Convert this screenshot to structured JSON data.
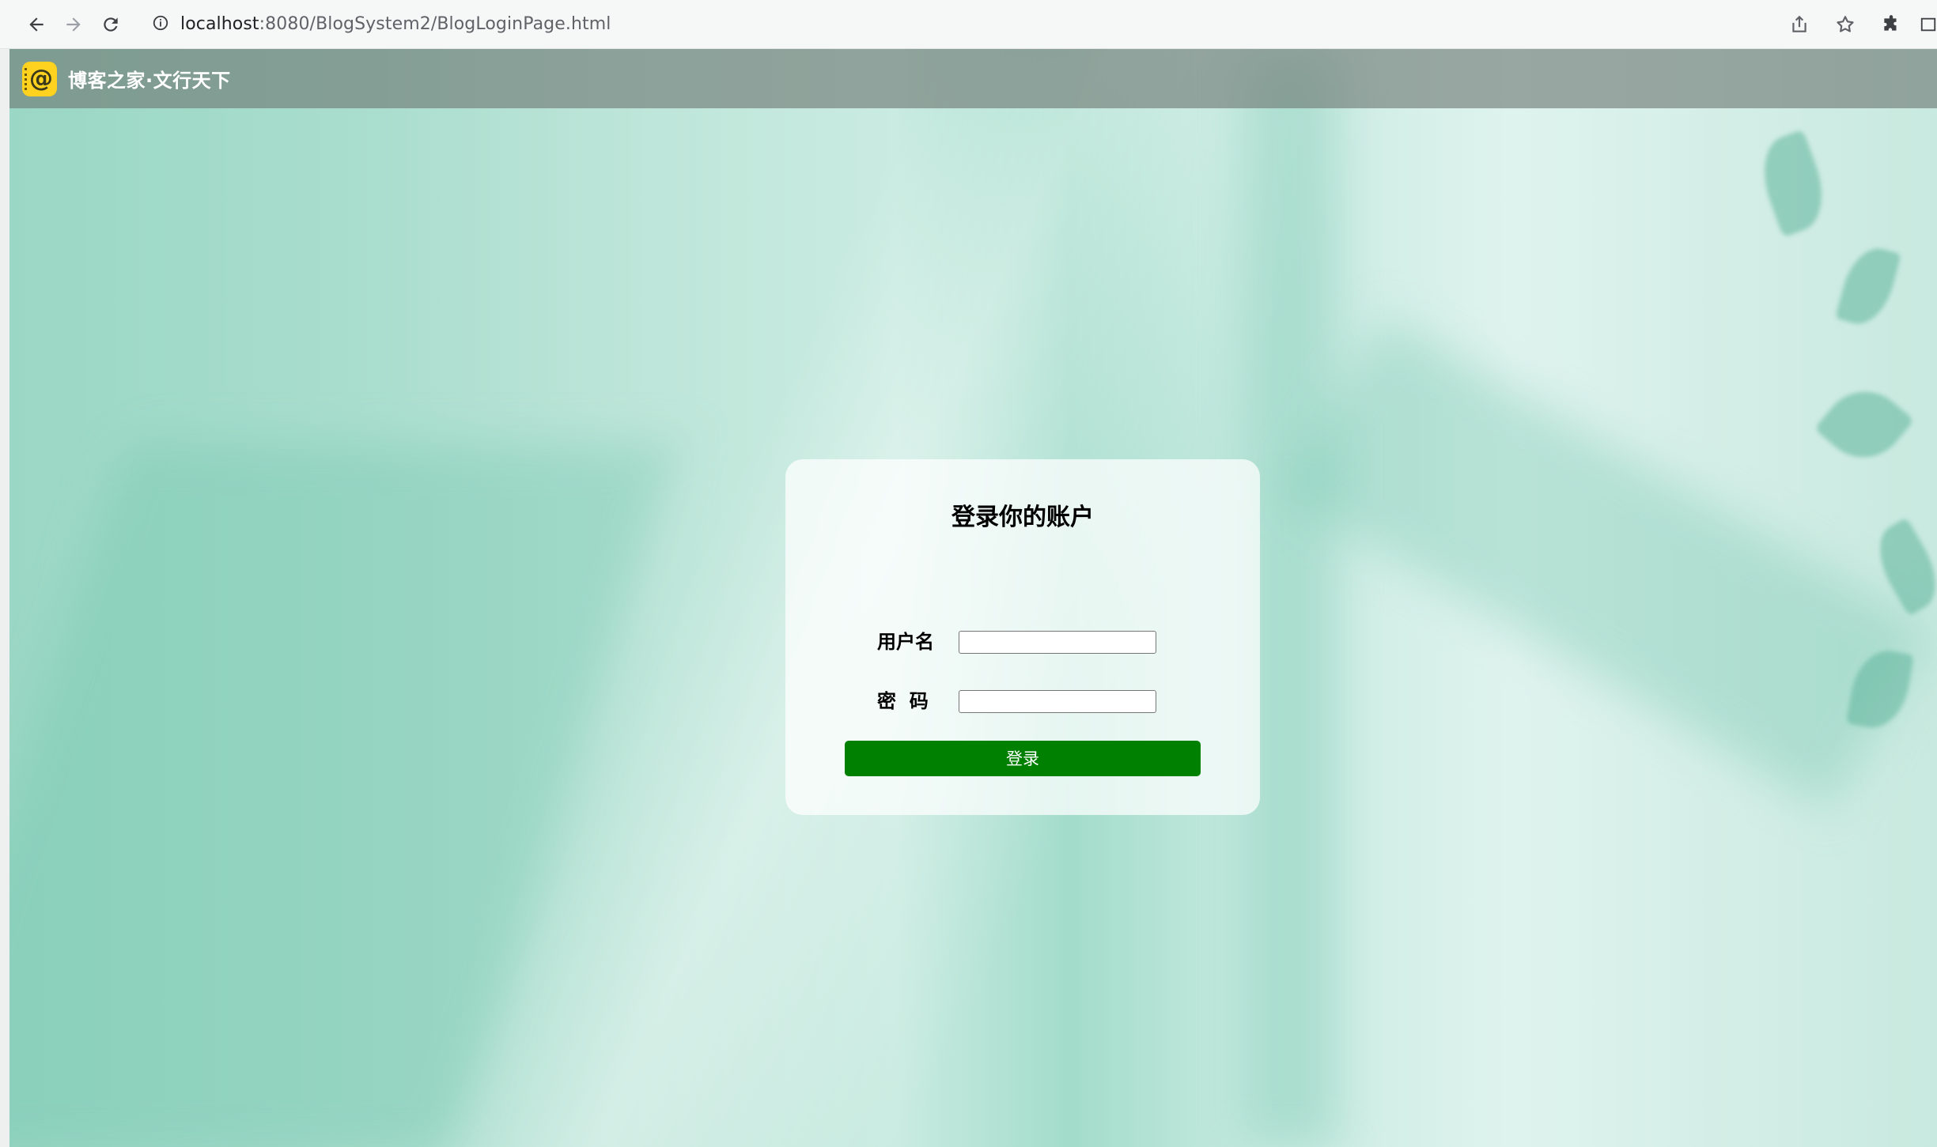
{
  "browser": {
    "url_host": "localhost",
    "url_path": ":8080/BlogSystem2/BlogLoginPage.html",
    "icons": {
      "back": "arrow-left-icon",
      "forward": "arrow-right-icon",
      "reload": "reload-icon",
      "site_info": "info-icon",
      "share": "share-icon",
      "bookmark": "star-icon",
      "extensions": "puzzle-icon",
      "side_panel": "side-panel-icon"
    }
  },
  "site_nav": {
    "logo_icon": "at-sign-notebook-icon",
    "title": "博客之家·文行天下"
  },
  "login": {
    "title": "登录你的账户",
    "username_label": "用户名",
    "username_value": "",
    "password_label": "密  码",
    "password_value": "",
    "submit_label": "登录"
  },
  "colors": {
    "button": "#008000",
    "logo": "#ffd21f"
  }
}
